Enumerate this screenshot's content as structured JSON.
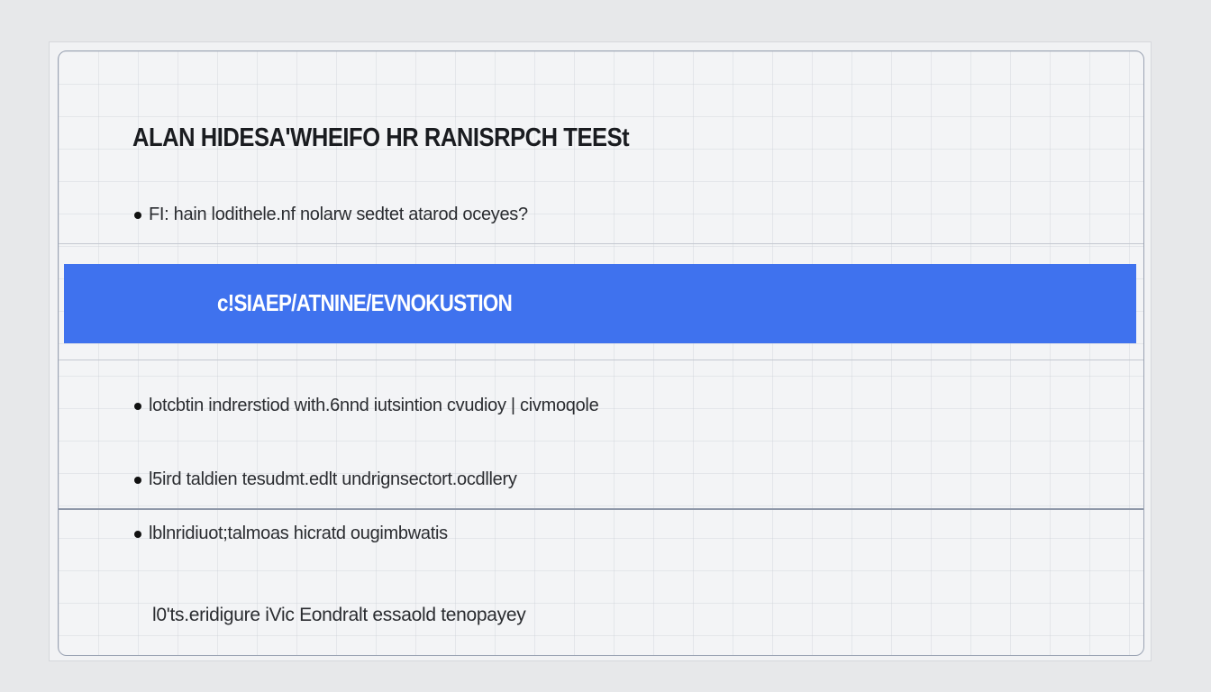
{
  "header": {
    "title": "ALAN HIDESA'WHEIFO HR RANISRPCH TEESt"
  },
  "intro": {
    "bullet": "FI: hain lodithele.nf nolarw sedtet atarod oceyes?"
  },
  "highlight": {
    "label": "c!SIAEP/ATNINE/EVNOKUSTION"
  },
  "bullets": [
    {
      "text": "lotcbtin indrerstiod with.6nnd iutsintion cvudioy | civmoqole"
    },
    {
      "text": "l5ird taldien tesudmt.edlt undrignsectort.ocdllery"
    },
    {
      "text": "lblnridiuot;talmoas hicratd ougimbwatis"
    }
  ],
  "footnote": {
    "text": "l0'ts.eridigure iVic Eondralt essaold tenopayey"
  },
  "colors": {
    "accent": "#3f72ee",
    "background": "#f3f4f6",
    "text": "#2a2c30"
  }
}
